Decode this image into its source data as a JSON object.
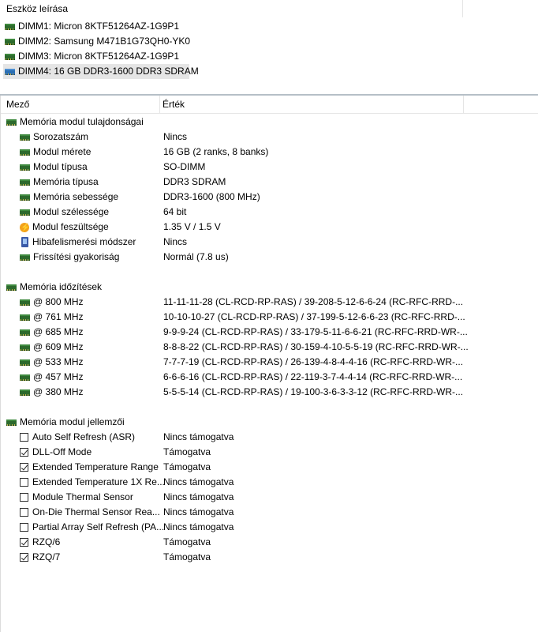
{
  "device_pane": {
    "header": "Eszköz leírása",
    "items": [
      {
        "label": "DIMM1: Micron 8KTF51264AZ-1G9P1",
        "icon": "green-memory-chip-icon",
        "selected": false
      },
      {
        "label": "DIMM2: Samsung M471B1G73QH0-YK0",
        "icon": "green-memory-chip-icon",
        "selected": false
      },
      {
        "label": "DIMM3: Micron 8KTF51264AZ-1G9P1",
        "icon": "green-memory-chip-icon",
        "selected": false
      },
      {
        "label": "DIMM4: 16 GB DDR3-1600 DDR3 SDRAM",
        "icon": "blue-memory-chip-icon",
        "selected": true
      }
    ]
  },
  "details_pane": {
    "columns": {
      "field": "Mező",
      "value": "Érték"
    },
    "groups": [
      {
        "title": "Memória modul tulajdonságai",
        "rows": [
          {
            "field": "Sorozatszám",
            "value": "Nincs",
            "icon": "chip"
          },
          {
            "field": "Modul mérete",
            "value": "16 GB (2 ranks, 8 banks)",
            "icon": "chip"
          },
          {
            "field": "Modul típusa",
            "value": "SO-DIMM",
            "icon": "chip"
          },
          {
            "field": "Memória típusa",
            "value": "DDR3 SDRAM",
            "icon": "chip"
          },
          {
            "field": "Memória sebessége",
            "value": "DDR3-1600 (800 MHz)",
            "icon": "chip"
          },
          {
            "field": "Modul szélessége",
            "value": "64 bit",
            "icon": "chip"
          },
          {
            "field": "Modul feszültsége",
            "value": "1.35 V / 1.5 V",
            "icon": "bolt"
          },
          {
            "field": "Hibafelismerési módszer",
            "value": "Nincs",
            "icon": "phone"
          },
          {
            "field": "Frissítési gyakoriság",
            "value": "Normál (7.8 us)",
            "icon": "chip"
          }
        ]
      },
      {
        "title": "Memória időzítések",
        "rows": [
          {
            "field": "@ 800 MHz",
            "value": "11-11-11-28  (CL-RCD-RP-RAS) / 39-208-5-12-6-6-24  (RC-RFC-RRD-..."
          },
          {
            "field": "@ 761 MHz",
            "value": "10-10-10-27  (CL-RCD-RP-RAS) / 37-199-5-12-6-6-23  (RC-RFC-RRD-..."
          },
          {
            "field": "@ 685 MHz",
            "value": "9-9-9-24  (CL-RCD-RP-RAS) / 33-179-5-11-6-6-21  (RC-RFC-RRD-WR-..."
          },
          {
            "field": "@ 609 MHz",
            "value": "8-8-8-22  (CL-RCD-RP-RAS) / 30-159-4-10-5-5-19  (RC-RFC-RRD-WR-..."
          },
          {
            "field": "@ 533 MHz",
            "value": "7-7-7-19  (CL-RCD-RP-RAS) / 26-139-4-8-4-4-16  (RC-RFC-RRD-WR-..."
          },
          {
            "field": "@ 457 MHz",
            "value": "6-6-6-16  (CL-RCD-RP-RAS) / 22-119-3-7-4-4-14  (RC-RFC-RRD-WR-..."
          },
          {
            "field": "@ 380 MHz",
            "value": "5-5-5-14  (CL-RCD-RP-RAS) / 19-100-3-6-3-3-12  (RC-RFC-RRD-WR-..."
          }
        ]
      },
      {
        "title": "Memória modul jellemzői",
        "rows": [
          {
            "field": "Auto Self Refresh (ASR)",
            "value": "Nincs támogatva",
            "checked": false
          },
          {
            "field": "DLL-Off Mode",
            "value": "Támogatva",
            "checked": true
          },
          {
            "field": "Extended Temperature Range",
            "value": "Támogatva",
            "checked": true
          },
          {
            "field": "Extended Temperature 1X Re...",
            "value": "Nincs támogatva",
            "checked": false
          },
          {
            "field": "Module Thermal Sensor",
            "value": "Nincs támogatva",
            "checked": false
          },
          {
            "field": "On-Die Thermal Sensor Rea...",
            "value": "Nincs támogatva",
            "checked": false
          },
          {
            "field": "Partial Array Self Refresh (PA...",
            "value": "Nincs támogatva",
            "checked": false
          },
          {
            "field": "RZQ/6",
            "value": "Támogatva",
            "checked": true
          },
          {
            "field": "RZQ/7",
            "value": "Támogatva",
            "checked": true
          }
        ]
      }
    ]
  }
}
